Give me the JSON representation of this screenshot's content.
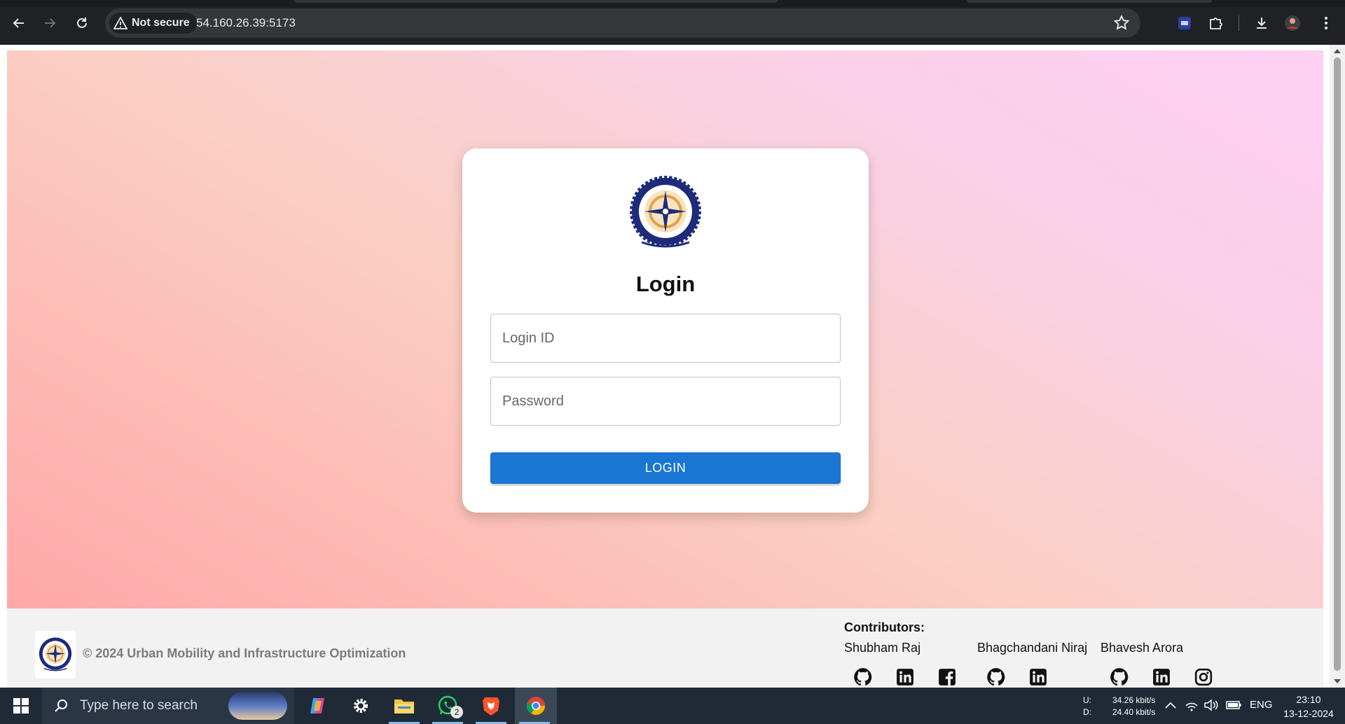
{
  "browser": {
    "security_label": "Not secure",
    "url": "54.160.26.39:5173"
  },
  "login": {
    "title": "Login",
    "login_id_placeholder": "Login ID",
    "password_placeholder": "Password",
    "button_label": "LOGIN"
  },
  "footer": {
    "copyright": "© 2024 Urban Mobility and Infrastructure Optimization",
    "contributors_title": "Contributors:",
    "contributors": [
      {
        "name": "Shubham Raj",
        "icons": [
          "github-icon",
          "linkedin-icon",
          "facebook-icon"
        ]
      },
      {
        "name": "Bhagchandani Niraj",
        "icons": [
          "github-icon",
          "linkedin-icon"
        ]
      },
      {
        "name": "Bhavesh Arora",
        "icons": [
          "github-icon",
          "linkedin-icon",
          "instagram-icon"
        ]
      }
    ]
  },
  "taskbar": {
    "search_placeholder": "Type here to search",
    "whatsapp_badge": "2",
    "upload_label": "U:",
    "download_label": "D:",
    "upload_speed": "34.26 kbit/s",
    "download_speed": "24.40 kbit/s",
    "language": "ENG",
    "time": "23:10",
    "date": "13-12-2024"
  },
  "colors": {
    "primary_button": "#1976d2",
    "gradient_start": "#ffa8a8",
    "gradient_end": "#fdd0f4"
  }
}
